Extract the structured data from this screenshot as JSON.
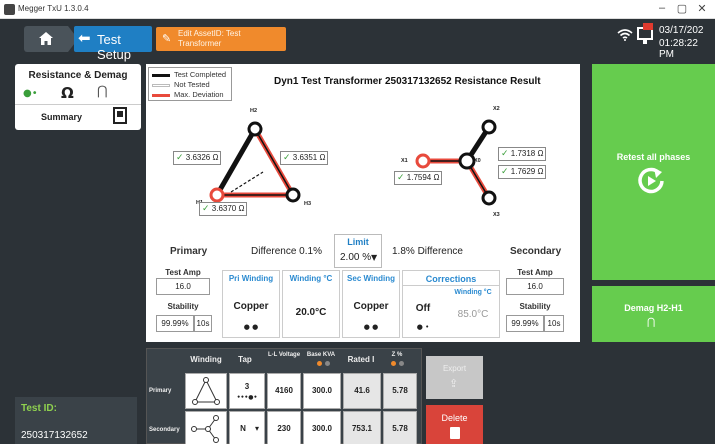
{
  "window": {
    "title": "Megger TxU 1.3.0.4",
    "minimize": "–",
    "maximize": "▢",
    "close": "✕"
  },
  "topbar": {
    "setup_label": "Test Setup",
    "edit_line1": "Edit AssetID: Test",
    "edit_line2": "Transformer",
    "date": "03/17/202",
    "time": "01:28:22 PM"
  },
  "left_panel": {
    "title": "Resistance & Demag",
    "dots": "●•",
    "ohm_icon": "Ω",
    "magnet_icon": "⋂",
    "summary": "Summary"
  },
  "test_id": {
    "label": "Test ID:",
    "value": "250317132652"
  },
  "legend": [
    {
      "label": "Test Completed",
      "color": "#111111"
    },
    {
      "label": "Not Tested",
      "color": "#ffffff"
    },
    {
      "label": "Max. Deviation",
      "color": "#e84a3c"
    }
  ],
  "main": {
    "title": "Dyn1 Test Transformer 250317132652 Resistance Result",
    "primary_nodes": {
      "h1": "H1",
      "h2": "H2",
      "h3": "H3"
    },
    "secondary_nodes": {
      "x0": "X0",
      "x1": "X1",
      "x2": "X2",
      "x3": "X3"
    },
    "primary_values": [
      "3.6326 Ω",
      "3.6351 Ω",
      "3.6370 Ω"
    ],
    "secondary_values": [
      "1.7318 Ω",
      "1.7629 Ω",
      "1.7594 Ω"
    ],
    "check": "✓",
    "primary_label": "Primary",
    "secondary_label": "Secondary",
    "primary_diff": "Difference  0.1%",
    "secondary_diff": "1.8%  Difference",
    "limit_title": "Limit",
    "limit_value": "2.00 %",
    "test_amp_label": "Test Amp",
    "primary_test_amp": "16.0",
    "secondary_test_amp": "16.0",
    "stability_label": "Stability",
    "primary_stability": "99.99%",
    "primary_stability_time": "10s",
    "secondary_stability": "99.99%",
    "secondary_stability_time": "10s",
    "pri_winding_title": "Pri Winding",
    "pri_winding_value": "Copper",
    "pri_winding_dots": "● ●",
    "winding_temp_title": "Winding °C",
    "winding_temp_value": "20.0°C",
    "sec_winding_title": "Sec Winding",
    "sec_winding_value": "Copper",
    "sec_winding_dots": "● ●",
    "corrections_title": "Corrections",
    "corrections_value": "Off",
    "corrections_dots": "● •",
    "corr_winding_title": "Winding °C",
    "corr_winding_value": "85.0°C"
  },
  "right_panel": {
    "retest_label": "Retest all phases",
    "demag_label": "Demag H2-H1",
    "demag_icon": "⋂"
  },
  "winding_table": {
    "headers": [
      "Winding",
      "Tap",
      "L-L Voltage",
      "Base KVA",
      "Rated I",
      "Z %"
    ],
    "rows": [
      {
        "label": "Primary",
        "tap": "3",
        "tap_dots": "•••●•",
        "voltage": "4160",
        "kva": "300.0",
        "rated_i": "41.6",
        "z": "5.78"
      },
      {
        "label": "Secondary",
        "tap": "N",
        "tap_caret": "▾",
        "voltage": "230",
        "kva": "300.0",
        "rated_i": "753.1",
        "z": "5.78"
      }
    ]
  },
  "actions": {
    "export": "Export",
    "export_icon": "⇪",
    "delete": "Delete"
  },
  "colors": {
    "accent_blue": "#1f7fc4",
    "orange": "#f08a2c",
    "green": "#66cc4e",
    "red": "#d9443a"
  }
}
